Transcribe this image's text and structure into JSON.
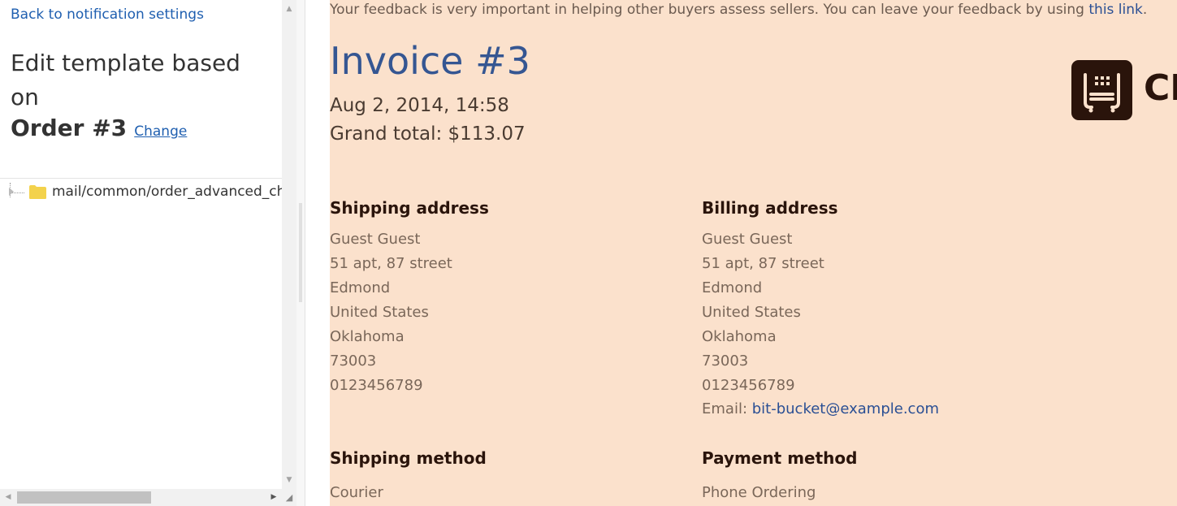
{
  "sidebar": {
    "back_link": "Back to notification settings",
    "edit_title": "Edit template based on",
    "order_name": "Order #3",
    "change_link": "Change",
    "tree_item": "mail/common/order_advanced_cha",
    "folder_color": "#f3d24c"
  },
  "preview": {
    "feedback_text": "Your feedback is very important in helping other buyers assess sellers. You can leave your feedback by using ",
    "feedback_link": "this link",
    "feedback_end": ".",
    "invoice_title": "Invoice #3",
    "invoice_date": "Aug 2, 2014, 14:58",
    "grand_total": "Grand total: $113.07",
    "logo_text": "CF",
    "background_color": "#fbe1cc",
    "shipping_address": {
      "title": "Shipping address",
      "name": "Guest  Guest",
      "street": "51 apt, 87 street",
      "city": "Edmond",
      "country": "United States",
      "state": "Oklahoma",
      "zip": "73003",
      "phone": "0123456789"
    },
    "billing_address": {
      "title": "Billing address",
      "name": "Guest  Guest",
      "street": "51 apt, 87 street",
      "city": "Edmond",
      "country": "United States",
      "state": "Oklahoma",
      "zip": "73003",
      "phone": "0123456789",
      "email_label": "Email: ",
      "email": "bit-bucket@example.com"
    },
    "shipping_method": {
      "title": "Shipping method",
      "value": "Courier"
    },
    "payment_method": {
      "title": "Payment method",
      "value": "Phone Ordering"
    }
  }
}
